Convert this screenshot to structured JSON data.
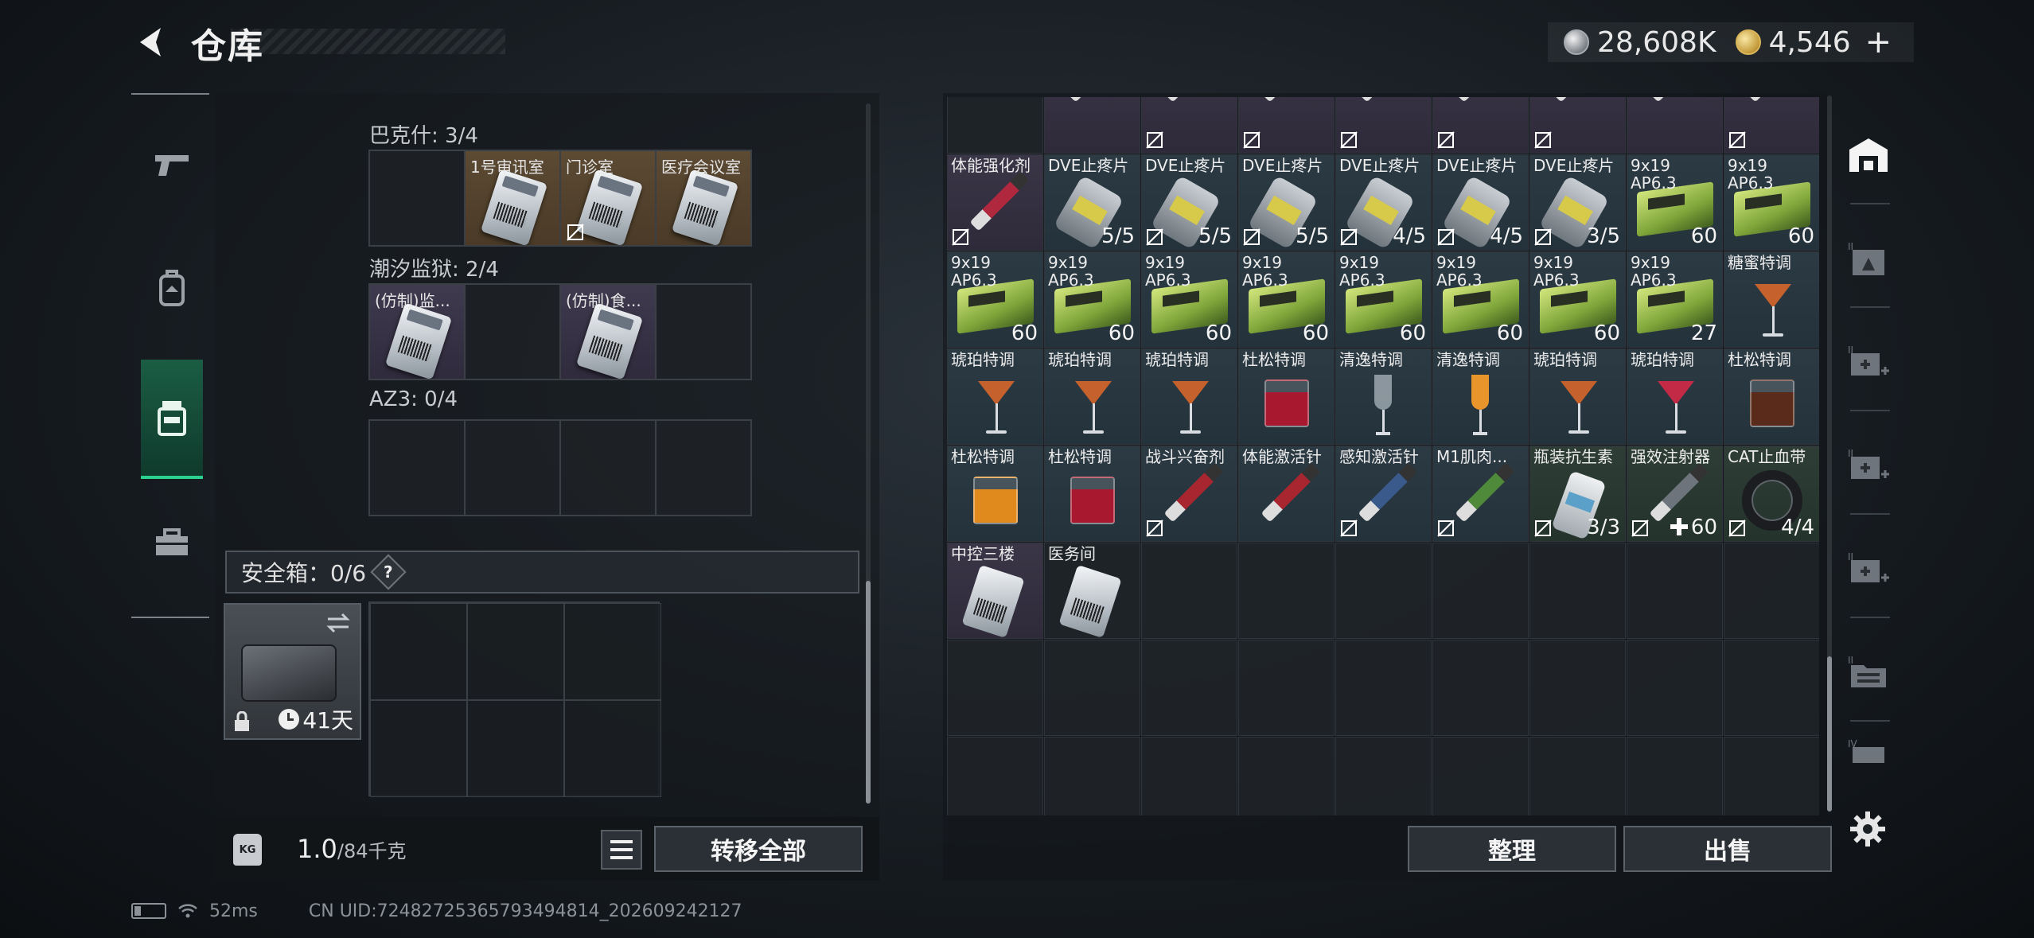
{
  "header": {
    "title": "仓库",
    "currency_silver": "28,608K",
    "currency_gold": "4,546",
    "gold_plus": "+"
  },
  "left_panel": {
    "sections": [
      {
        "label": "巴克什: 3/4",
        "slots": [
          "",
          "1号审讯室",
          "门诊室",
          "医疗会议室"
        ]
      },
      {
        "label": "潮汐监狱: 2/4",
        "slots": [
          "(仿制)监...",
          "",
          "(仿制)食...",
          ""
        ]
      },
      {
        "label": "AZ3: 0/4",
        "slots": [
          "",
          "",
          "",
          ""
        ]
      }
    ],
    "safebox_label": "安全箱：0/6",
    "help": "?",
    "safebox_days": "41天",
    "weight_value": "1.0",
    "weight_max": "/84千克",
    "kg_badge": "KG",
    "transfer_all": "转移全部"
  },
  "right_panel": {
    "rows": [
      [
        {
          "name": "",
          "qty": "",
          "style": "dark",
          "icon": "jar",
          "noshare": false
        },
        {
          "name": "",
          "qty": "",
          "style": "purple",
          "icon": "syringe-partial",
          "noshare": false
        },
        {
          "name": "",
          "qty": "",
          "style": "purple",
          "icon": "syringe-partial",
          "noshare": true
        },
        {
          "name": "",
          "qty": "",
          "style": "purple",
          "icon": "syringe-partial",
          "noshare": true
        },
        {
          "name": "",
          "qty": "",
          "style": "purple",
          "icon": "syringe-partial",
          "noshare": true
        },
        {
          "name": "",
          "qty": "",
          "style": "purple",
          "icon": "syringe-partial",
          "noshare": true
        },
        {
          "name": "",
          "qty": "",
          "style": "purple",
          "icon": "syringe-partial",
          "noshare": true
        },
        {
          "name": "",
          "qty": "",
          "style": "purple",
          "icon": "syringe-partial",
          "noshare": false
        },
        {
          "name": "",
          "qty": "",
          "style": "purple",
          "icon": "syringe-partial",
          "noshare": true
        }
      ],
      [
        {
          "name": "体能强化剂",
          "qty": "",
          "style": "purple",
          "icon": "syringe",
          "noshare": true
        },
        {
          "name": "DVE止疼片",
          "qty": "5/5",
          "style": "teal",
          "icon": "pill",
          "noshare": false
        },
        {
          "name": "DVE止疼片",
          "qty": "5/5",
          "style": "teal",
          "icon": "pill",
          "noshare": true
        },
        {
          "name": "DVE止疼片",
          "qty": "5/5",
          "style": "teal",
          "icon": "pill",
          "noshare": true
        },
        {
          "name": "DVE止疼片",
          "qty": "4/5",
          "style": "teal",
          "icon": "pill",
          "noshare": true
        },
        {
          "name": "DVE止疼片",
          "qty": "4/5",
          "style": "teal",
          "icon": "pill",
          "noshare": true
        },
        {
          "name": "DVE止疼片",
          "qty": "3/5",
          "style": "teal",
          "icon": "pill",
          "noshare": true
        },
        {
          "name": "9x19 AP6.3",
          "qty": "60",
          "style": "teal",
          "icon": "ammo",
          "noshare": false
        },
        {
          "name": "9x19 AP6.3",
          "qty": "60",
          "style": "teal",
          "icon": "ammo",
          "noshare": false
        }
      ],
      [
        {
          "name": "9x19 AP6.3",
          "qty": "60",
          "style": "teal",
          "icon": "ammo",
          "noshare": false
        },
        {
          "name": "9x19 AP6.3",
          "qty": "60",
          "style": "teal",
          "icon": "ammo",
          "noshare": false
        },
        {
          "name": "9x19 AP6.3",
          "qty": "60",
          "style": "teal",
          "icon": "ammo",
          "noshare": false
        },
        {
          "name": "9x19 AP6.3",
          "qty": "60",
          "style": "teal",
          "icon": "ammo",
          "noshare": false
        },
        {
          "name": "9x19 AP6.3",
          "qty": "60",
          "style": "teal",
          "icon": "ammo",
          "noshare": false
        },
        {
          "name": "9x19 AP6.3",
          "qty": "60",
          "style": "teal",
          "icon": "ammo",
          "noshare": false
        },
        {
          "name": "9x19 AP6.3",
          "qty": "60",
          "style": "teal",
          "icon": "ammo",
          "noshare": false
        },
        {
          "name": "9x19 AP6.3",
          "qty": "27",
          "style": "teal",
          "icon": "ammo",
          "noshare": false
        },
        {
          "name": "糖蜜特调",
          "qty": "",
          "style": "teal",
          "icon": "martini-orange",
          "noshare": false
        }
      ],
      [
        {
          "name": "琥珀特调",
          "qty": "",
          "style": "teal",
          "icon": "martini-orange",
          "noshare": false
        },
        {
          "name": "琥珀特调",
          "qty": "",
          "style": "teal",
          "icon": "martini-orange",
          "noshare": false
        },
        {
          "name": "琥珀特调",
          "qty": "",
          "style": "teal",
          "icon": "martini-orange",
          "noshare": false
        },
        {
          "name": "杜松特调",
          "qty": "",
          "style": "teal",
          "icon": "glass-red",
          "noshare": false
        },
        {
          "name": "清逸特调",
          "qty": "",
          "style": "teal",
          "icon": "flute-clear",
          "noshare": false
        },
        {
          "name": "清逸特调",
          "qty": "",
          "style": "teal",
          "icon": "flute-orange",
          "noshare": false
        },
        {
          "name": "琥珀特调",
          "qty": "",
          "style": "teal",
          "icon": "martini-orange",
          "noshare": false
        },
        {
          "name": "琥珀特调",
          "qty": "",
          "style": "teal",
          "icon": "martini-red",
          "noshare": false
        },
        {
          "name": "杜松特调",
          "qty": "",
          "style": "teal",
          "icon": "glass-dark",
          "noshare": false
        }
      ],
      [
        {
          "name": "杜松特调",
          "qty": "",
          "style": "teal",
          "icon": "glass-amber",
          "noshare": false
        },
        {
          "name": "杜松特调",
          "qty": "",
          "style": "teal",
          "icon": "glass-red",
          "noshare": false
        },
        {
          "name": "战斗兴奋剂",
          "qty": "",
          "style": "teal",
          "icon": "syringe-red",
          "noshare": true
        },
        {
          "name": "体能激活针",
          "qty": "",
          "style": "teal",
          "icon": "syringe-red",
          "noshare": false
        },
        {
          "name": "感知激活针",
          "qty": "",
          "style": "teal",
          "icon": "syringe-blue",
          "noshare": true
        },
        {
          "name": "M1肌肉...",
          "qty": "",
          "style": "teal",
          "icon": "syringe-green",
          "noshare": true
        },
        {
          "name": "瓶装抗生素",
          "qty": "3/3",
          "style": "green",
          "icon": "bottle",
          "noshare": true
        },
        {
          "name": "强效注射器",
          "qty": "60",
          "style": "green",
          "icon": "syringe-grey",
          "noshare": true,
          "plus": true
        },
        {
          "name": "CAT止血带",
          "qty": "4/4",
          "style": "green",
          "icon": "tourniquet",
          "noshare": true
        }
      ],
      [
        {
          "name": "中控三楼",
          "qty": "",
          "style": "purple",
          "icon": "card",
          "noshare": false
        },
        {
          "name": "医务间",
          "qty": "",
          "style": "dark",
          "icon": "card",
          "noshare": false
        }
      ]
    ],
    "sort_label": "整理",
    "sell_label": "出售"
  },
  "status": {
    "ping": "52ms",
    "uid": "CN UID:7248272536579349481​4_202609242127"
  },
  "colors": {
    "accent_green": "#2cd08e",
    "martini_orange": "#c4612c",
    "martini_red": "#c22a45",
    "glass_red": "#a8192f",
    "glass_amber": "#e08a1e"
  }
}
